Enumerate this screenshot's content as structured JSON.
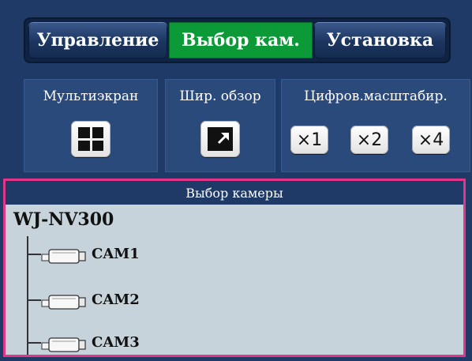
{
  "tabs": [
    {
      "label": "Управление"
    },
    {
      "label": "Выбор кам."
    },
    {
      "label": "Установка"
    }
  ],
  "controls": {
    "multiscreen": {
      "title": "Мультиэкран",
      "icon": "quad-screen-icon"
    },
    "wideview": {
      "title": "Шир. обзор",
      "icon": "expand-arrow-icon"
    },
    "digital_zoom": {
      "title": "Цифров.масштабир.",
      "buttons": [
        "×1",
        "×2",
        "×4"
      ]
    }
  },
  "camera_select": {
    "header": "Выбор камеры",
    "device": "WJ-NV300",
    "cameras": [
      "CAM1",
      "CAM2",
      "CAM3"
    ]
  },
  "colors": {
    "panel_bg": "#1f3a66",
    "active_tab": "#0c9a38",
    "tree_bg": "#c6d3da",
    "highlight_border": "#e0378a"
  }
}
